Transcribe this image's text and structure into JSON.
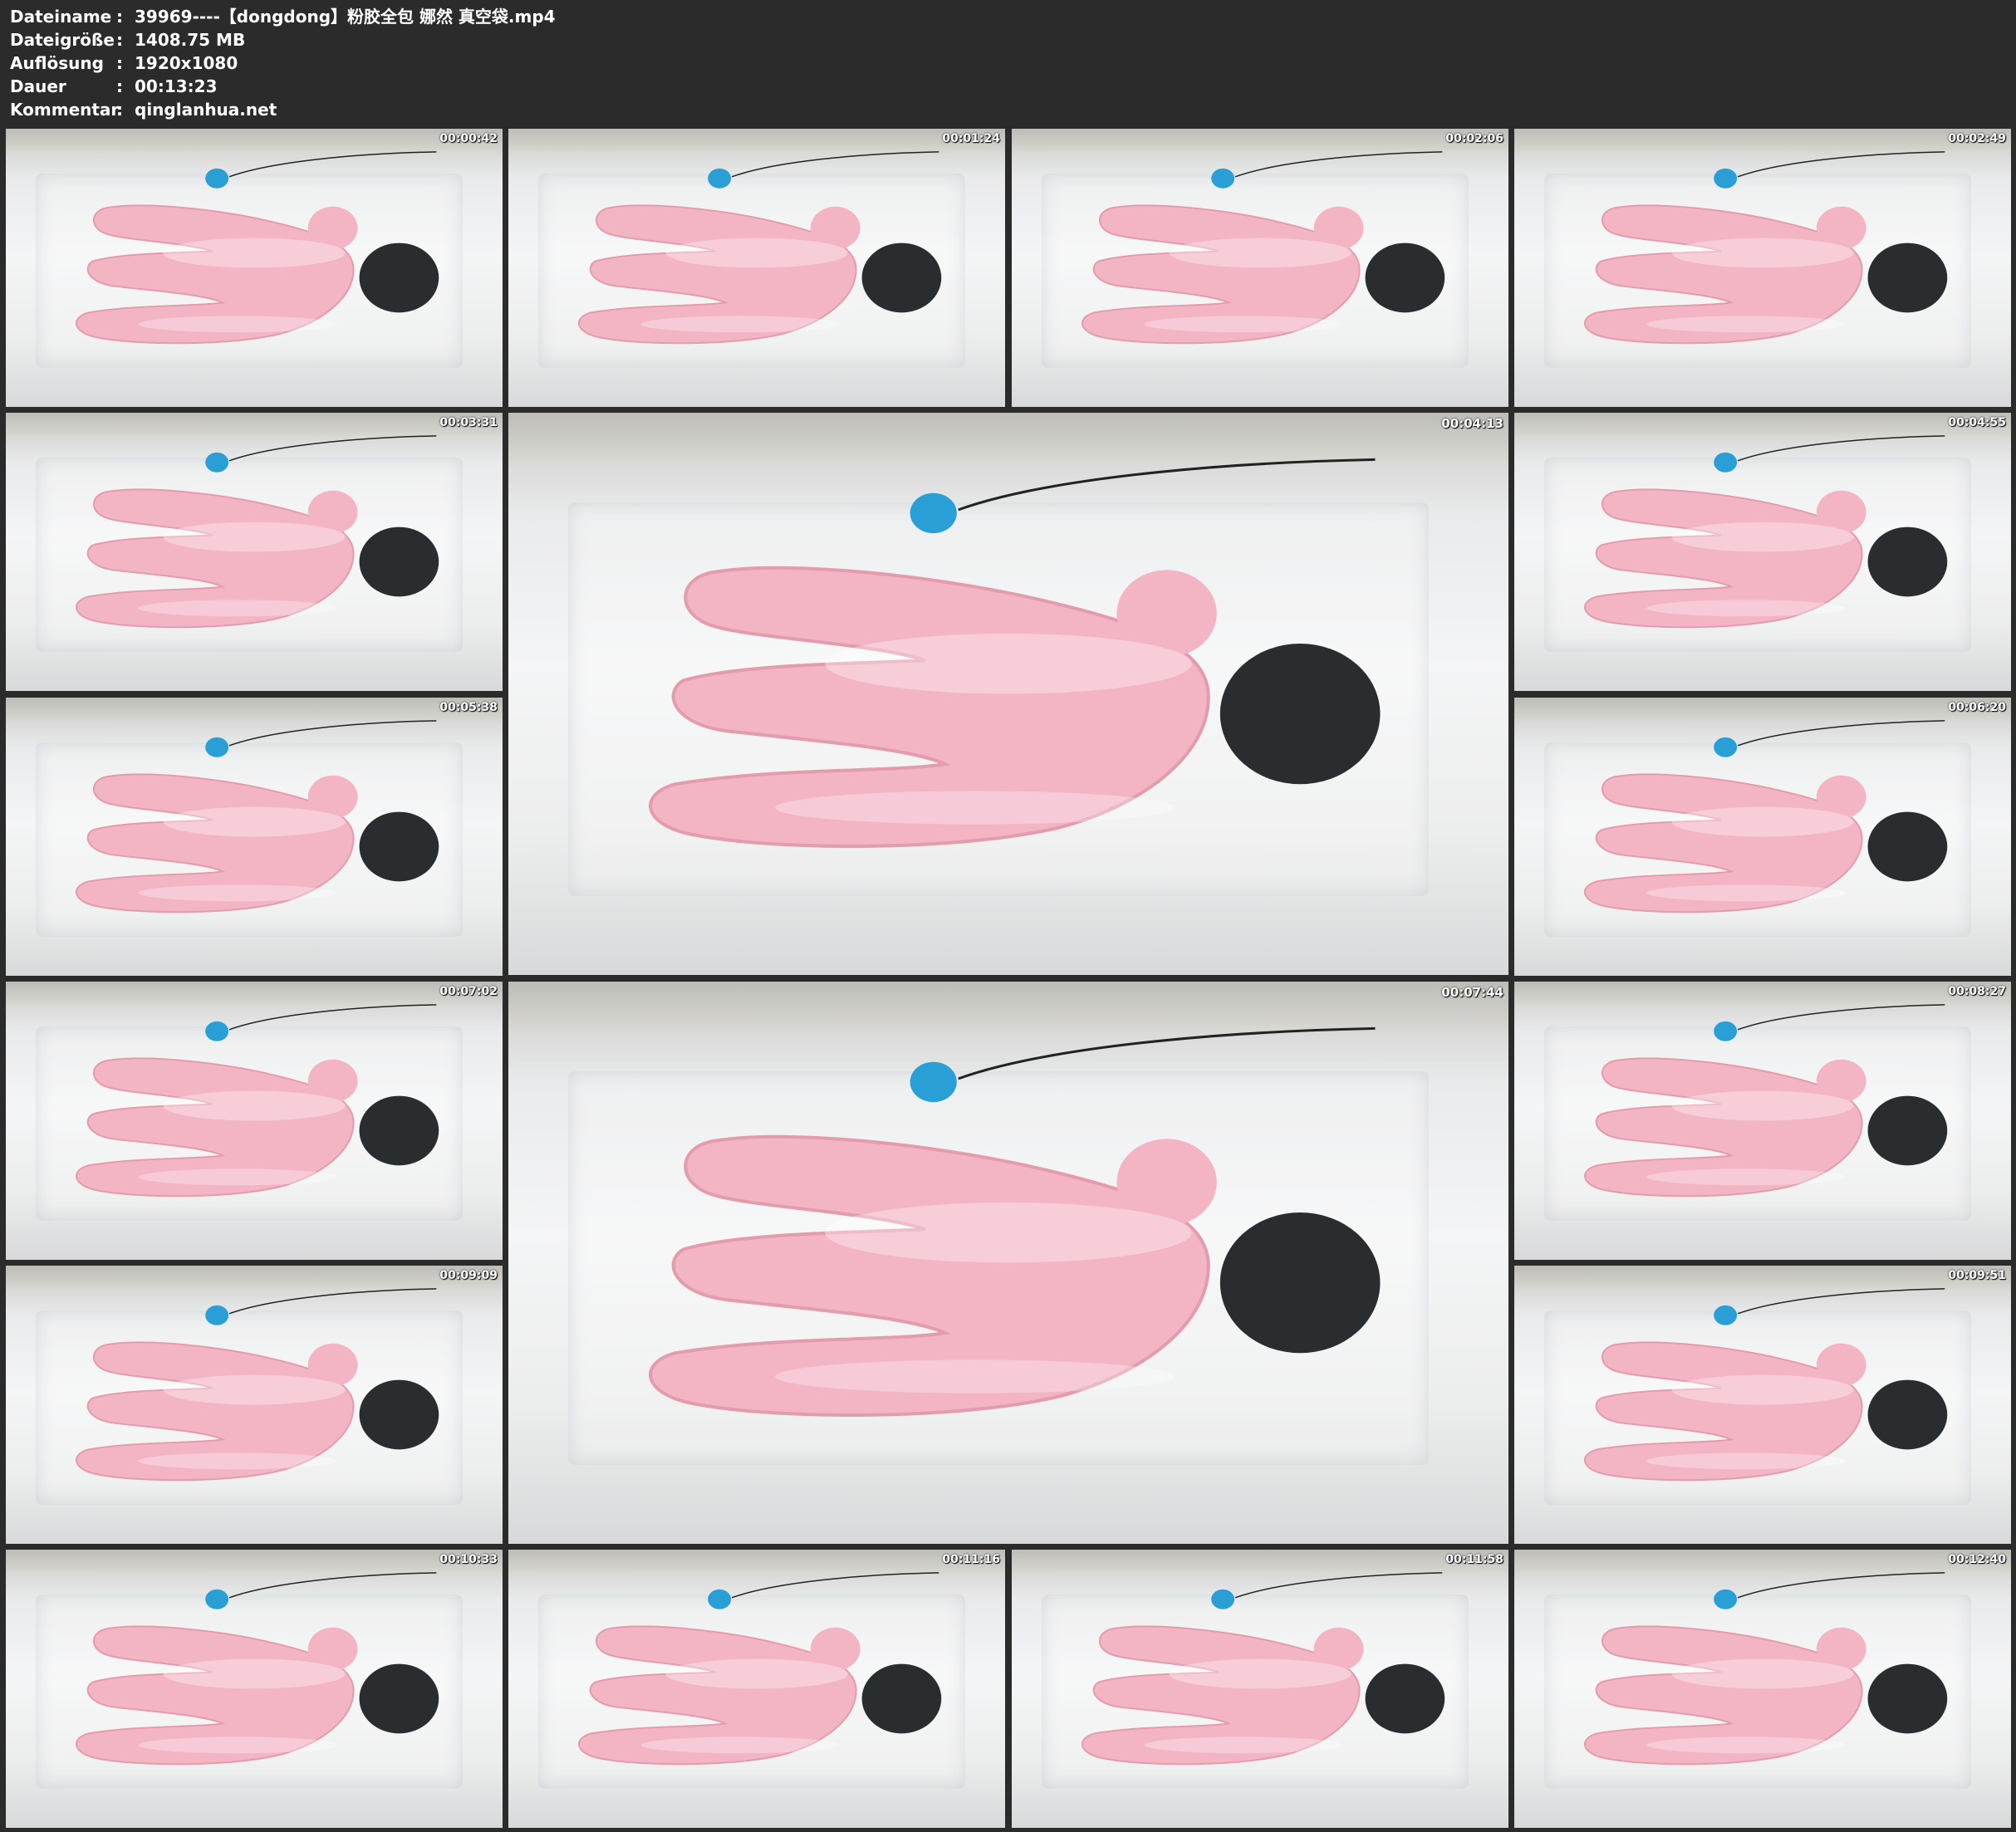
{
  "info": [
    {
      "key": "Dateiname",
      "value": "39969----【dongdong】粉胶全包 娜然 真空袋.mp4"
    },
    {
      "key": "Dateigröße",
      "value": "1408.75 MB"
    },
    {
      "key": "Auflösung",
      "value": "1920x1080"
    },
    {
      "key": "Dauer",
      "value": "00:13:23"
    },
    {
      "key": "Kommentar",
      "value": "qinglanhua.net"
    }
  ],
  "separator": ":",
  "thumbnails": [
    {
      "time": "00:00:42",
      "big": false
    },
    {
      "time": "00:01:24",
      "big": false
    },
    {
      "time": "00:02:06",
      "big": false
    },
    {
      "time": "00:02:49",
      "big": false
    },
    {
      "time": "00:03:31",
      "big": false
    },
    {
      "time": "00:04:13",
      "big": true
    },
    {
      "time": "00:04:55",
      "big": false
    },
    {
      "time": "00:05:38",
      "big": false
    },
    {
      "time": "00:06:20",
      "big": false
    },
    {
      "time": "00:07:02",
      "big": false
    },
    {
      "time": "00:07:44",
      "big": true
    },
    {
      "time": "00:08:27",
      "big": false
    },
    {
      "time": "00:09:09",
      "big": false
    },
    {
      "time": "00:09:51",
      "big": false
    },
    {
      "time": "00:10:33",
      "big": false
    },
    {
      "time": "00:11:16",
      "big": false
    },
    {
      "time": "00:11:58",
      "big": false
    },
    {
      "time": "00:12:40",
      "big": false
    }
  ],
  "colors": {
    "background": "#2b2b2b",
    "figure": "#f3b4c4",
    "hood": "#2a2d2f",
    "pump": "#2a9fd6"
  }
}
